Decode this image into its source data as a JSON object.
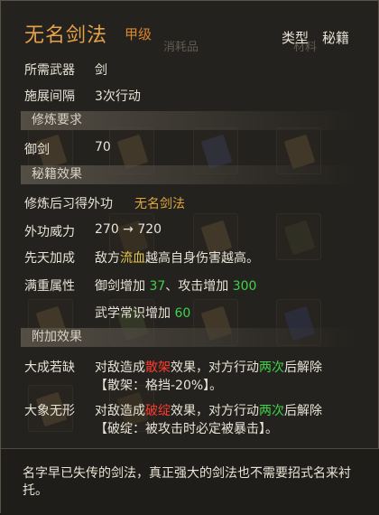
{
  "header": {
    "title": "无名剑法",
    "grade": "甲级",
    "type_label": "类型",
    "type_value": "秘籍",
    "bg_tab_1": "消耗品",
    "bg_tab_2": "材料"
  },
  "basic": {
    "weapon_label": "所需武器",
    "weapon_value": "剑",
    "interval_label": "施展间隔",
    "interval_value": "3次行动"
  },
  "requirement": {
    "section": "修炼要求",
    "skill_label": "御剑",
    "skill_value": "70"
  },
  "effects": {
    "section": "秘籍效果",
    "gain_label": "修炼后习得外功",
    "gain_value": "无名剑法",
    "power_label": "外功威力",
    "power_value": "270 → 720",
    "innate_label": "先天加成",
    "innate_pre": "敌方",
    "innate_hl": "流血",
    "innate_post": "越高自身伤害越高。",
    "full_label": "满重属性",
    "full_line1_a": "御剑增加 ",
    "full_line1_b": "37",
    "full_line1_c": "、攻击增加 ",
    "full_line1_d": "300",
    "full_line2_a": "武学常识增加 ",
    "full_line2_b": "60"
  },
  "extra": {
    "section": "附加效果",
    "e1_label": "大成若缺",
    "e1_a": "对敌造成",
    "e1_b": "散架",
    "e1_c": "效果，对方行动",
    "e1_d": "两次",
    "e1_e": "后解除",
    "e1_line2": "【散架：格挡-20%】。",
    "e2_label": "大象无形",
    "e2_a": "对敌造成",
    "e2_b": "破绽",
    "e2_c": "效果，对方行动",
    "e2_d": "两次",
    "e2_e": "后解除",
    "e2_line2": "【破绽：被攻击时必定被暴击】。"
  },
  "footer": {
    "description": "名字早已失传的剑法，真正强大的剑法也不需要招式名来衬托。"
  },
  "colors": {
    "title": "#e6a24a",
    "grade": "#d9862c",
    "highlight_red": "#ff3b2f",
    "highlight_green": "#3fd24a"
  }
}
